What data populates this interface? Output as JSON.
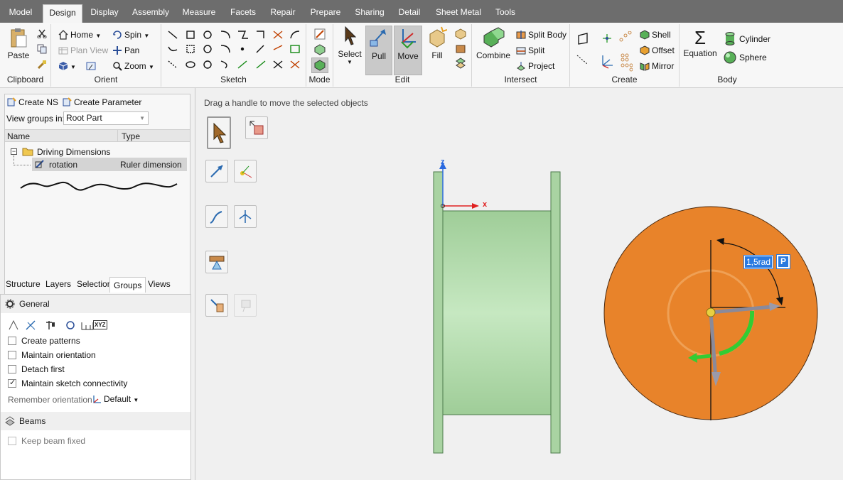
{
  "tabs": [
    "Model",
    "Design",
    "Display",
    "Assembly",
    "Measure",
    "Facets",
    "Repair",
    "Prepare",
    "Sharing",
    "Detail",
    "Sheet Metal",
    "Tools"
  ],
  "ribbon": {
    "clipboard": {
      "label": "Clipboard",
      "paste": "Paste"
    },
    "orient": {
      "label": "Orient",
      "home": "Home",
      "plan_view": "Plan View",
      "spin": "Spin",
      "pan": "Pan",
      "zoom": "Zoom"
    },
    "sketch": {
      "label": "Sketch"
    },
    "mode": {
      "label": "Mode"
    },
    "edit": {
      "label": "Edit",
      "select": "Select",
      "pull": "Pull",
      "move": "Move",
      "fill": "Fill"
    },
    "intersect": {
      "label": "Intersect",
      "combine": "Combine",
      "split_body": "Split Body",
      "split": "Split",
      "project": "Project"
    },
    "create": {
      "label": "Create",
      "shell": "Shell",
      "offset": "Offset",
      "mirror": "Mirror"
    },
    "body": {
      "label": "Body",
      "equation": "Equation",
      "cylinder": "Cylinder",
      "sphere": "Sphere"
    }
  },
  "groups_panel": {
    "create_ns": "Create NS",
    "create_parameter": "Create Parameter",
    "view_groups_label": "View groups in:",
    "view_groups_value": "Root Part",
    "col_name": "Name",
    "col_type": "Type",
    "tree": [
      {
        "name": "Driving Dimensions",
        "type": ""
      },
      {
        "name": "rotation",
        "type": "Ruler dimension"
      }
    ]
  },
  "panel_tabs": [
    "Structure",
    "Layers",
    "Selection",
    "Groups",
    "Views"
  ],
  "options": {
    "general": "General",
    "create_patterns": "Create patterns",
    "maintain_orientation": "Maintain orientation",
    "detach_first": "Detach first",
    "maintain_sketch": "Maintain sketch connectivity",
    "remember_orientation": "Remember orientation",
    "default": "Default",
    "beams": "Beams",
    "keep_beam_fixed": "Keep beam fixed",
    "xyz": "XYZ"
  },
  "canvas": {
    "hint": "Drag a handle to move the selected objects",
    "axis_z": "z",
    "axis_x": "x",
    "dimension": "1,5rad",
    "dim_badge": "P"
  },
  "colors": {
    "ribbon_tabs": "#6d6d6d",
    "cylinder": "#a9d3a2",
    "disk": "#e8832a",
    "move_handle": "#33cc33"
  }
}
